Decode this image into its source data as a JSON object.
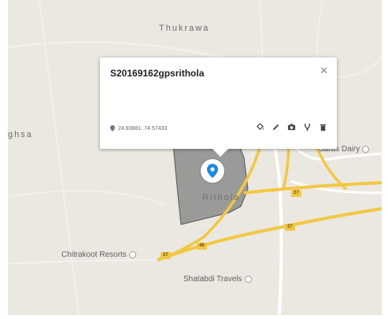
{
  "map": {
    "places": {
      "thukrawa": "Thukrawa",
      "ghsa": "ghsa",
      "rithola": "Rithola",
      "saras_dairy": "Saras Dairy",
      "chitrakoot_resorts": "Chitrakoot Resorts",
      "shatabdi_travels": "Shatabdi Travels"
    },
    "road_badges": [
      "27",
      "27",
      "27",
      "48"
    ],
    "colors": {
      "land": "#ebe8e1",
      "roads": "#ffffff",
      "highway": "#f2c744",
      "polygon_fill": "#8a8a8a",
      "marker": "#1e88e5"
    }
  },
  "popup": {
    "title": "S20169162gpsrithola",
    "close_icon": "close-icon",
    "coordinates": "24.83881, 74.57433",
    "tools": [
      "paint-bucket-icon",
      "pencil-icon",
      "camera-icon",
      "fork-icon",
      "trash-icon"
    ]
  },
  "marker": {
    "icon": "map-pin-icon"
  }
}
